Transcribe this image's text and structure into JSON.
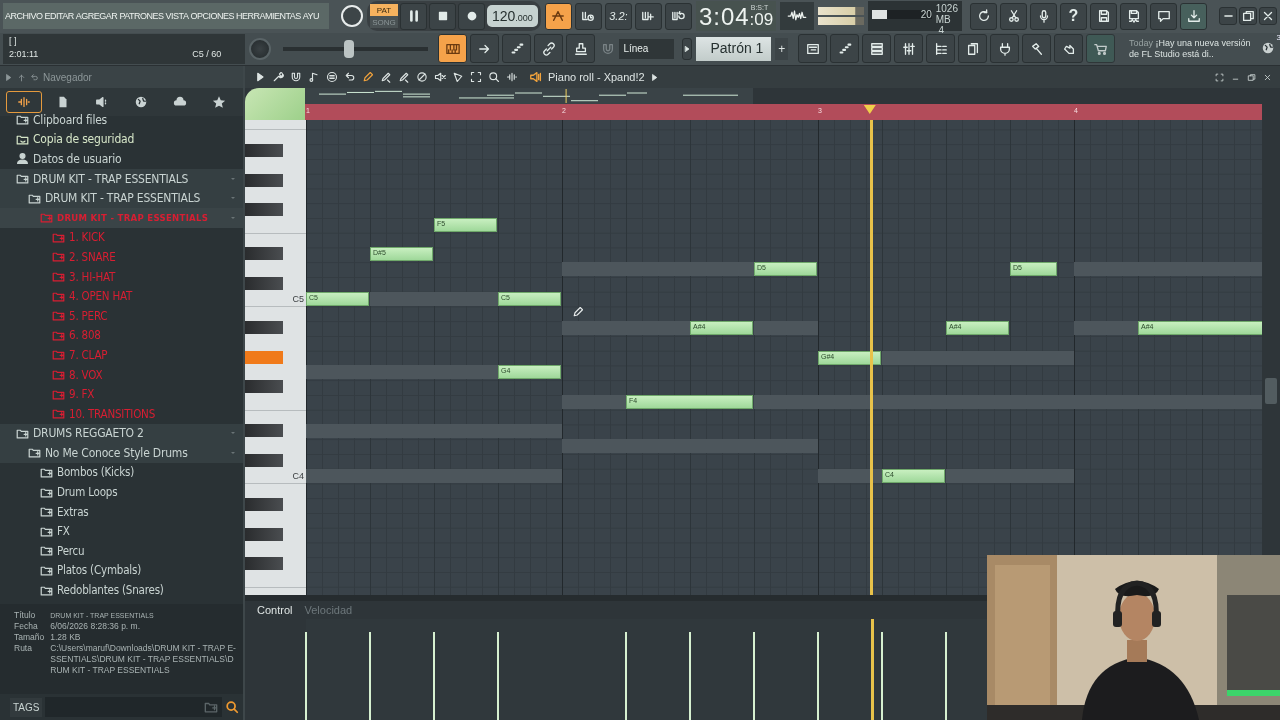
{
  "menu": [
    "ARCHIVO",
    "EDITAR",
    "AGREGAR",
    "PATRONES",
    "VISTA",
    "OPCIONES",
    "HERRAMIENTAS",
    "AYU"
  ],
  "transport": {
    "modes": [
      {
        "label": "PAT",
        "selected": true
      },
      {
        "label": "SONG",
        "selected": false
      }
    ],
    "tempo": "120",
    "tempo_fraction": ".000"
  },
  "top_buttons": [
    {
      "active": true
    },
    {
      "active": false
    },
    {
      "active": false,
      "label": "3.2:"
    },
    {
      "active": false
    },
    {
      "active": false
    }
  ],
  "time_display": {
    "main": "3:04",
    "small": ":09",
    "unit": "B:S:T"
  },
  "cpu": {
    "level": 0.25,
    "cpu": "20",
    "memory": "1026 MB",
    "polyphony": "4"
  },
  "system_buttons": [
    {
      "kind": "refresh"
    },
    {
      "kind": "scissors"
    },
    {
      "kind": "microphone"
    },
    {
      "kind": "help",
      "label": "?"
    },
    {
      "kind": "save"
    },
    {
      "kind": "save-as"
    },
    {
      "kind": "chat"
    },
    {
      "kind": "download"
    }
  ],
  "hint_panel": {
    "line_1": "[   ]",
    "time": "2:01:11",
    "note": "C5 / 60"
  },
  "pitch_slider": {
    "level": 0.45
  },
  "view_buttons": [
    {
      "active": true
    },
    {
      "active": false
    },
    {
      "active": false
    },
    {
      "active": false
    },
    {
      "active": false
    }
  ],
  "snap": {
    "value": "Línea"
  },
  "pattern": {
    "name": "Patrón 1",
    "add_label": "+"
  },
  "window_buttons": [
    {
      "active": false
    },
    {
      "active": false
    },
    {
      "active": false
    },
    {
      "active": false
    },
    {
      "active": false
    },
    {
      "active": false
    },
    {
      "active": false
    },
    {
      "active": false
    },
    {
      "active": false
    }
  ],
  "news": {
    "date": "Today",
    "message": "¡Hay una nueva versión de FL Studio está di..",
    "count": "3"
  },
  "browser": {
    "title": "Navegador",
    "tabs": [
      {
        "selected": true
      },
      {
        "selected": false
      },
      {
        "selected": false
      },
      {
        "selected": false
      },
      {
        "selected": false
      },
      {
        "selected": false
      }
    ],
    "tree": [
      {
        "label": "Clipboard files",
        "kind": "folder",
        "color": "#c9d4d2",
        "selected": false,
        "expanded": false
      },
      {
        "label": "Copia de seguridad",
        "kind": "backup",
        "color": "#d6e6c8",
        "selected": false,
        "expanded": false
      },
      {
        "label": "Datos de usuario",
        "kind": "user",
        "color": "#c9d4d2",
        "selected": false,
        "expanded": false
      },
      {
        "label": "DRUM KIT - TRAP ESSENTIALS",
        "kind": "folder",
        "color": "#c9d4d2",
        "selected": false,
        "expanded": true,
        "children": [
          {
            "label": "DRUM KIT - TRAP ESSENTIALS",
            "kind": "folder",
            "color": "#c9d4d2",
            "selected": false,
            "expanded": true,
            "children": [
              {
                "label": "DRUM KIT - TRAP ESSENTIALS",
                "kind": "folder",
                "color": "#d81e32",
                "selected": true,
                "expanded": true,
                "children": [
                  {
                    "label": "1. KICK",
                    "kind": "folder",
                    "color": "#d81e32",
                    "selected": false,
                    "expanded": false
                  },
                  {
                    "label": "2. SNARE",
                    "kind": "folder",
                    "color": "#d81e32",
                    "selected": false,
                    "expanded": false
                  },
                  {
                    "label": "3. HI-HAT",
                    "kind": "folder",
                    "color": "#d81e32",
                    "selected": false,
                    "expanded": false
                  },
                  {
                    "label": "4. OPEN HAT",
                    "kind": "folder",
                    "color": "#d81e32",
                    "selected": false,
                    "expanded": false
                  },
                  {
                    "label": "5. PERC",
                    "kind": "folder",
                    "color": "#d81e32",
                    "selected": false,
                    "expanded": false
                  },
                  {
                    "label": "6. 808",
                    "kind": "folder",
                    "color": "#d81e32",
                    "selected": false,
                    "expanded": false
                  },
                  {
                    "label": "7. CLAP",
                    "kind": "folder",
                    "color": "#d81e32",
                    "selected": false,
                    "expanded": false
                  },
                  {
                    "label": "8. VOX",
                    "kind": "folder",
                    "color": "#d81e32",
                    "selected": false,
                    "expanded": false
                  },
                  {
                    "label": "9. FX",
                    "kind": "folder",
                    "color": "#d81e32",
                    "selected": false,
                    "expanded": false
                  },
                  {
                    "label": "10. TRANSITIONS",
                    "kind": "folder",
                    "color": "#d81e32",
                    "selected": false,
                    "expanded": false
                  }
                ]
              }
            ]
          }
        ]
      },
      {
        "label": "DRUMS REGGAETO 2",
        "kind": "folder",
        "color": "#c9d4d2",
        "selected": false,
        "expanded": true,
        "children": [
          {
            "label": "No Me Conoce Style Drums",
            "kind": "folder",
            "color": "#c9d4d2",
            "selected": false,
            "expanded": true,
            "children": [
              {
                "label": "Bombos (Kicks)",
                "kind": "folder",
                "color": "#c9d4d2",
                "selected": false,
                "expanded": false
              },
              {
                "label": "Drum Loops",
                "kind": "folder",
                "color": "#c9d4d2",
                "selected": false,
                "expanded": false
              },
              {
                "label": "Extras",
                "kind": "folder",
                "color": "#c9d4d2",
                "selected": false,
                "expanded": false
              },
              {
                "label": "FX",
                "kind": "folder",
                "color": "#c9d4d2",
                "selected": false,
                "expanded": false
              },
              {
                "label": "Percu",
                "kind": "folder",
                "color": "#c9d4d2",
                "selected": false,
                "expanded": false
              },
              {
                "label": "Platos (Cymbals)",
                "kind": "folder",
                "color": "#c9d4d2",
                "selected": false,
                "expanded": false
              },
              {
                "label": "Redoblantes (Snares)",
                "kind": "folder",
                "color": "#c9d4d2",
                "selected": false,
                "expanded": false
              }
            ]
          }
        ]
      }
    ],
    "info": [
      {
        "label": "Título",
        "value": "DRUM KIT - TRAP ESSENTIALS"
      },
      {
        "label": "Fecha",
        "value": "6/06/2026 8:28:36 p. m."
      },
      {
        "label": "Tamaño",
        "value": "1.28 KB"
      },
      {
        "label": "Ruta",
        "value": "C:\\Users\\maruf\\Downloads\\DRUM KIT - TRAP E-SSENTIALS\\DRUM KIT - TRAP ESSENTIALS\\DRUM KIT - TRAP ESSENTIALS"
      }
    ],
    "tags_label": "TAGS"
  },
  "piano_roll": {
    "title": "Piano roll - Xpand!2",
    "ruler": [
      "1",
      "2",
      "3",
      "4"
    ],
    "key_labels": [
      "C5",
      "C4"
    ],
    "notes": [
      {
        "label": "C5"
      },
      {
        "label": "D#5"
      },
      {
        "label": "F5"
      },
      {
        "label": "C5"
      },
      {
        "label": "G4"
      },
      {
        "label": "F4"
      },
      {
        "label": "A#4"
      },
      {
        "label": "D5"
      },
      {
        "label": "G#4"
      },
      {
        "label": "C4"
      },
      {
        "label": "A#4"
      },
      {
        "label": "D5"
      },
      {
        "label": "A#4"
      }
    ],
    "control_label": "Control",
    "lane_label": "Velocidad"
  }
}
